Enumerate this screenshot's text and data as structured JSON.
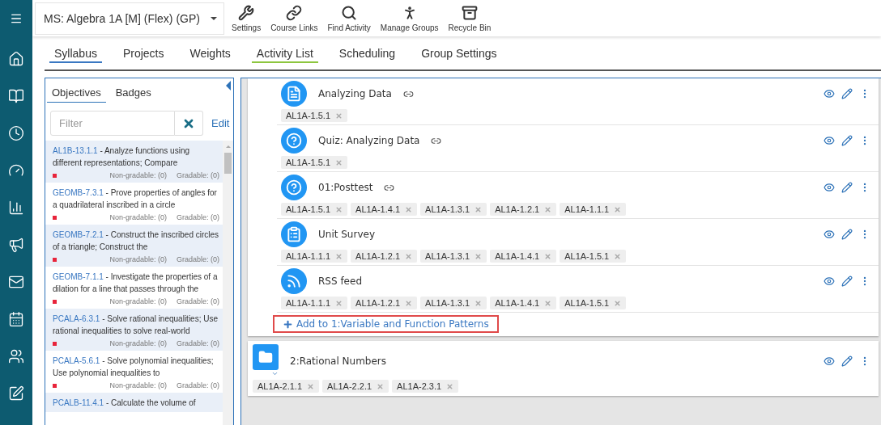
{
  "course_selector": {
    "value": "MS: Algebra 1A [M] (Flex) (GP)"
  },
  "toolbar": [
    {
      "kind": "settings",
      "label": "Settings"
    },
    {
      "kind": "links",
      "label": "Course Links"
    },
    {
      "kind": "find",
      "label": "Find Activity"
    },
    {
      "kind": "groups",
      "label": "Manage Groups"
    },
    {
      "kind": "recycle",
      "label": "Recycle Bin"
    }
  ],
  "tabs": [
    {
      "label": "Syllabus",
      "selected": true,
      "color": "#3a78c2"
    },
    {
      "label": "Projects",
      "selected": false
    },
    {
      "label": "Weights",
      "selected": false
    },
    {
      "label": "Activity List",
      "selected": true,
      "color": "#8dc63f"
    },
    {
      "label": "Scheduling",
      "selected": false
    },
    {
      "label": "Group Settings",
      "selected": false
    }
  ],
  "objectives_panel": {
    "tabs": [
      {
        "label": "Objectives",
        "selected": true
      },
      {
        "label": "Badges",
        "selected": false
      }
    ],
    "filter": {
      "placeholder": "Filter"
    },
    "edit_link": "Edit",
    "items": [
      {
        "code": "AL1B-13.1.1",
        "description": "- Analyze functions using different representations; Compare",
        "non_gradable": "Non-gradable: (0)",
        "gradable": "Gradable: (0)"
      },
      {
        "code": "GEOMB-7.3.1",
        "description": "- Prove properties of angles for a quadrilateral inscribed in a circle",
        "non_gradable": "Non-gradable: (0)",
        "gradable": "Gradable: (0)"
      },
      {
        "code": "GEOMB-7.2.1",
        "description": "- Construct the inscribed circles of a triangle; Construct the",
        "non_gradable": "Non-gradable: (0)",
        "gradable": "Gradable: (0)"
      },
      {
        "code": "GEOMB-7.1.1",
        "description": "- Investigate the properties of a dilation for a line that passes through the",
        "non_gradable": "Non-gradable: (0)",
        "gradable": "Gradable: (0)"
      },
      {
        "code": "PCALA-6.3.1",
        "description": "- Solve rational inequalities; Use rational inequalities to solve real-world",
        "non_gradable": "Non-gradable: (0)",
        "gradable": "Gradable: (0)"
      },
      {
        "code": "PCALA-5.6.1",
        "description": "- Solve polynomial inequalities; Use polynomial inequalities to",
        "non_gradable": "Non-gradable: (0)",
        "gradable": "Gradable: (0)"
      },
      {
        "code": "PCALB-11.4.1",
        "description": "- Calculate the volume of"
      }
    ]
  },
  "unit": {
    "activities": [
      {
        "kind": "page",
        "title": "Analyzing Data",
        "linked": true,
        "tags": [
          "AL1A-1.5.1"
        ]
      },
      {
        "kind": "quiz",
        "title": "Quiz: Analyzing Data",
        "linked": true,
        "tags": [
          "AL1A-1.5.1"
        ]
      },
      {
        "kind": "quiz",
        "title": "01:Posttest",
        "linked": true,
        "tags": [
          "AL1A-1.5.1",
          "AL1A-1.4.1",
          "AL1A-1.3.1",
          "AL1A-1.2.1",
          "AL1A-1.1.1"
        ]
      },
      {
        "kind": "survey",
        "title": "Unit Survey",
        "linked": false,
        "tags": [
          "AL1A-1.1.1",
          "AL1A-1.2.1",
          "AL1A-1.3.1",
          "AL1A-1.4.1",
          "AL1A-1.5.1"
        ]
      },
      {
        "kind": "rss",
        "title": "RSS feed",
        "linked": false,
        "tags": [
          "AL1A-1.1.1",
          "AL1A-1.2.1",
          "AL1A-1.3.1",
          "AL1A-1.4.1",
          "AL1A-1.5.1"
        ]
      }
    ],
    "add_link": {
      "label": "Add to 1:Variable and Function Patterns",
      "highlighted": true
    }
  },
  "next_unit": {
    "title": "2:Rational Numbers",
    "tags": [
      "AL1A-2.1.1",
      "AL1A-2.2.1",
      "AL1A-2.3.1"
    ]
  }
}
